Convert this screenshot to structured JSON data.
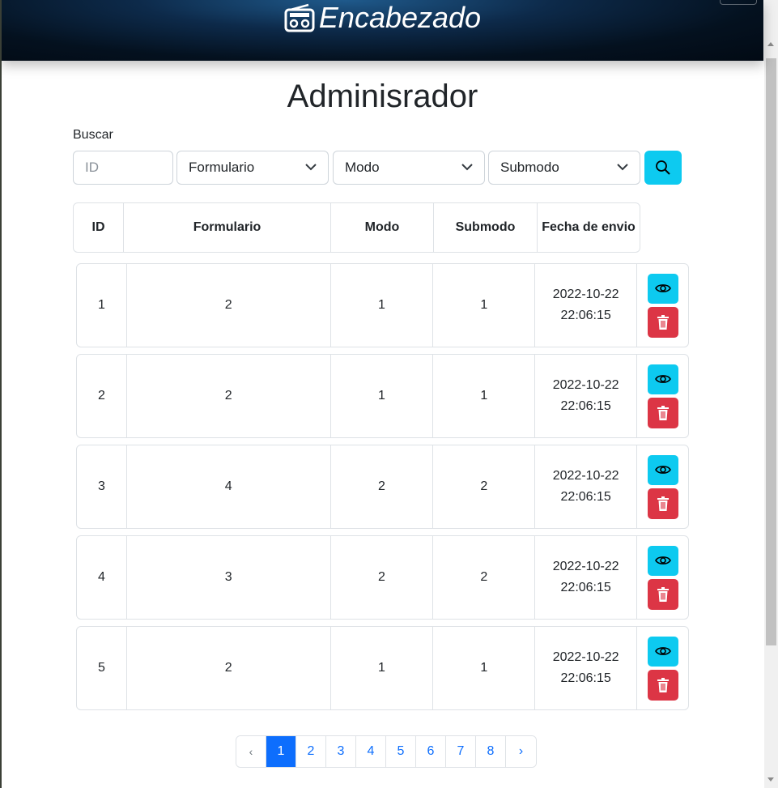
{
  "header": {
    "brand": "Encabezado"
  },
  "page": {
    "title": "Adminisrador"
  },
  "search": {
    "label": "Buscar",
    "id_placeholder": "ID",
    "formulario_select": "Formulario",
    "modo_select": "Modo",
    "submodo_select": "Submodo"
  },
  "table": {
    "headers": [
      "ID",
      "Formulario",
      "Modo",
      "Submodo",
      "Fecha de envio"
    ],
    "rows": [
      {
        "id": "1",
        "formulario": "2",
        "modo": "1",
        "submodo": "1",
        "fecha": "2022-10-22 22:06:15"
      },
      {
        "id": "2",
        "formulario": "2",
        "modo": "1",
        "submodo": "1",
        "fecha": "2022-10-22 22:06:15"
      },
      {
        "id": "3",
        "formulario": "4",
        "modo": "2",
        "submodo": "2",
        "fecha": "2022-10-22 22:06:15"
      },
      {
        "id": "4",
        "formulario": "3",
        "modo": "2",
        "submodo": "2",
        "fecha": "2022-10-22 22:06:15"
      },
      {
        "id": "5",
        "formulario": "2",
        "modo": "1",
        "submodo": "1",
        "fecha": "2022-10-22 22:06:15"
      }
    ]
  },
  "pagination": {
    "prev": "‹",
    "pages": [
      "1",
      "2",
      "3",
      "4",
      "5",
      "6",
      "7",
      "8"
    ],
    "next": "›",
    "active": "1"
  },
  "icons": {
    "brand": "radio-icon",
    "search": "search-icon",
    "view": "eye-icon",
    "delete": "trash-icon"
  },
  "colors": {
    "info": "#0dcaf0",
    "danger": "#dc3545",
    "primary": "#0d6efd"
  }
}
